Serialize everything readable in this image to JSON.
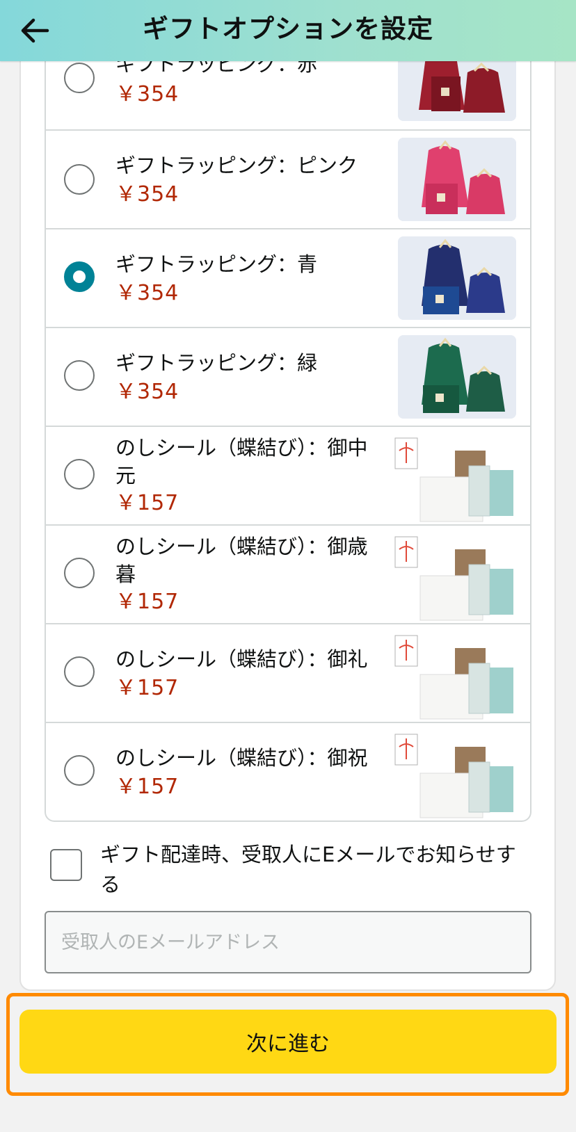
{
  "header": {
    "title": "ギフトオプションを設定",
    "back_icon": "arrow-left-icon"
  },
  "options": [
    {
      "label": "ギフトラッピング：赤",
      "price": "￥354",
      "selected": false,
      "thumb": "gift-bag-red",
      "color": "#9e1f2e"
    },
    {
      "label": "ギフトラッピング：ピンク",
      "price": "￥354",
      "selected": false,
      "thumb": "gift-bag-pink",
      "color": "#e0406e"
    },
    {
      "label": "ギフトラッピング：青",
      "price": "￥354",
      "selected": true,
      "thumb": "gift-bag-blue",
      "color": "#1d2e6b"
    },
    {
      "label": "ギフトラッピング：緑",
      "price": "￥354",
      "selected": false,
      "thumb": "gift-bag-green",
      "color": "#1c6b4e"
    },
    {
      "label": "のしシール（蝶結び）：御中元",
      "price": "￥157",
      "selected": false,
      "thumb": "noshi-box"
    },
    {
      "label": "のしシール（蝶結び）：御歳暮",
      "price": "￥157",
      "selected": false,
      "thumb": "noshi-box"
    },
    {
      "label": "のしシール（蝶結び）：御礼",
      "price": "￥157",
      "selected": false,
      "thumb": "noshi-box"
    },
    {
      "label": "のしシール（蝶結び）：御祝",
      "price": "￥157",
      "selected": false,
      "thumb": "noshi-box"
    }
  ],
  "notify": {
    "label": "ギフト配達時、受取人にEメールでお知らせする",
    "checked": false
  },
  "email": {
    "placeholder": "受取人のEメールアドレス",
    "value": ""
  },
  "next_button": {
    "label": "次に進む"
  },
  "colors": {
    "accent": "#008296",
    "price": "#b12704",
    "button": "#ffd814",
    "focus": "#ff8a00"
  }
}
